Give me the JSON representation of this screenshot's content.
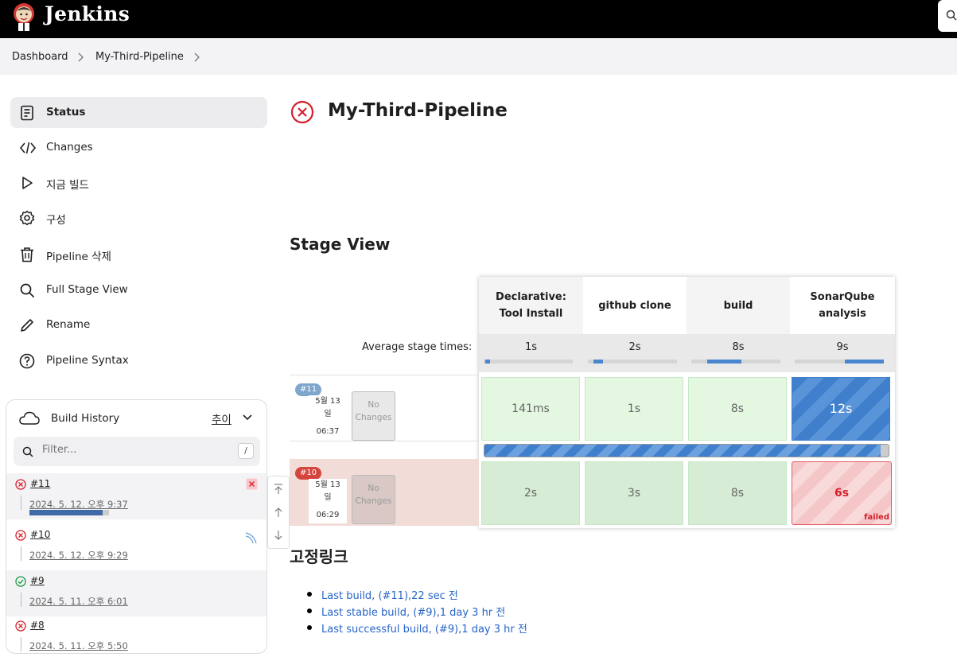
{
  "app": {
    "brand": "Jenkins"
  },
  "breadcrumb": {
    "items": [
      "Dashboard",
      "My-Third-Pipeline"
    ]
  },
  "sidebar": {
    "items": [
      {
        "label": "Status",
        "icon": "document-icon",
        "active": true
      },
      {
        "label": "Changes",
        "icon": "code-icon"
      },
      {
        "label": "지금 빌드",
        "icon": "play-icon"
      },
      {
        "label": "구성",
        "icon": "gear-icon"
      },
      {
        "label": "Pipeline 삭제",
        "icon": "trash-icon"
      },
      {
        "label": "Full Stage View",
        "icon": "search-icon"
      },
      {
        "label": "Rename",
        "icon": "pencil-icon"
      },
      {
        "label": "Pipeline Syntax",
        "icon": "help-icon"
      }
    ]
  },
  "build_history": {
    "title": "Build History",
    "trend_label": "추이",
    "filter_placeholder": "Filter...",
    "filter_shortcut": "/",
    "builds": [
      {
        "number": "#11",
        "date": "2024. 5. 12. 오후 9:37",
        "status": "failed",
        "progress": 0.92
      },
      {
        "number": "#10",
        "date": "2024. 5. 12. 오후 9:29",
        "status": "failed"
      },
      {
        "number": "#9",
        "date": "2024. 5. 11. 오후 6:01",
        "status": "success"
      },
      {
        "number": "#8",
        "date": "2024. 5. 11. 오후 5:50",
        "status": "failed"
      }
    ]
  },
  "main": {
    "title": "My-Third-Pipeline",
    "status_color": "#d4202c",
    "stage_view_heading": "Stage View",
    "average_label": "Average stage times:",
    "stages": [
      {
        "name_line1": "Declarative:",
        "name_line2": "Tool Install",
        "avg": "1s",
        "avg_fill": [
          0.02,
          0.07
        ]
      },
      {
        "name_line1": "github clone",
        "name_line2": "",
        "avg": "2s",
        "avg_fill": [
          0.06,
          0.17
        ]
      },
      {
        "name_line1": "build",
        "name_line2": "",
        "avg": "8s",
        "avg_fill": [
          0.18,
          0.56
        ]
      },
      {
        "name_line1": "SonarQube",
        "name_line2": "analysis",
        "avg": "9s",
        "avg_fill": [
          0.56,
          1.0
        ]
      }
    ],
    "runs": [
      {
        "badge": "#11",
        "date_line1": "5월 13",
        "date_line2": "일",
        "time": "06:37",
        "changes": "No Changes",
        "cells": [
          "141ms",
          "1s",
          "8s",
          "12s"
        ],
        "overall_progress": 0.98
      },
      {
        "badge": "#10",
        "date_line1": "5월 13",
        "date_line2": "일",
        "time": "06:29",
        "changes": "No Changes",
        "cells": [
          "2s",
          "3s",
          "8s",
          "6s"
        ],
        "failed_label": "failed"
      }
    ],
    "permalinks_heading": "고정링크",
    "permalinks": [
      "Last build, (#11),22 sec 전",
      "Last stable build, (#9),1 day 3 hr 전",
      "Last successful build, (#9),1 day 3 hr 전"
    ]
  }
}
